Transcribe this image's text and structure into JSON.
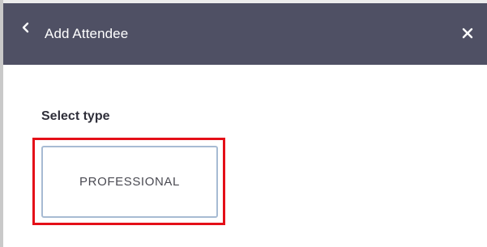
{
  "header": {
    "title": "Add Attendee",
    "back_icon": "chevron-left-icon",
    "close_icon": "close-icon",
    "background_color": "#4f5064"
  },
  "form": {
    "section_label": "Select type",
    "options": [
      {
        "label": "PROFESSIONAL"
      }
    ],
    "highlight_color": "#e40f18"
  }
}
